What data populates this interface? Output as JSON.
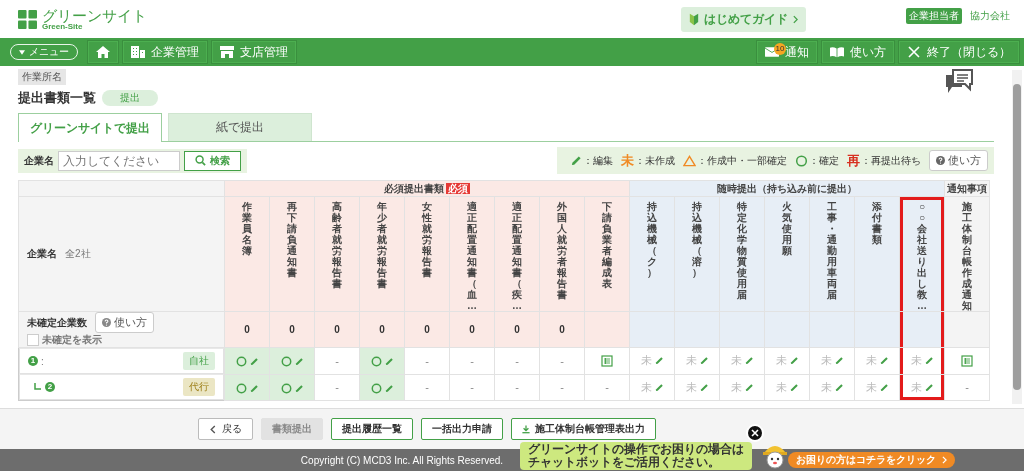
{
  "header": {
    "logo": {
      "name": "グリーンサイト",
      "subtitle": "Green-Site"
    },
    "guide_button": "はじめてガイド",
    "role_badge": "企業担当者",
    "company_link": "協力会社"
  },
  "navbar": {
    "menu_button": "メニュー",
    "items": [
      {
        "label": "企業管理",
        "kind": "building"
      },
      {
        "label": "支店管理",
        "kind": "store"
      }
    ],
    "notification": {
      "label": "通知",
      "count": "10"
    },
    "help": "使い方",
    "exit": "終了（閉じる）"
  },
  "site_label": "作業所名",
  "page": {
    "title": "提出書類一覧",
    "status": "提出"
  },
  "tabs": [
    {
      "label": "グリーンサイトで提出",
      "selected": true
    },
    {
      "label": "紙で提出",
      "selected": false
    }
  ],
  "search": {
    "label": "企業名",
    "placeholder": "入力してください",
    "button": "検索"
  },
  "legend": {
    "items": [
      {
        "kind": "pencil",
        "label": "：編集"
      },
      {
        "kind": "char",
        "symbol": "未",
        "color": "#f08a24",
        "label": "：未作成"
      },
      {
        "kind": "triangle",
        "label": "：作成中・一部確定"
      },
      {
        "kind": "circle",
        "label": "：確定"
      },
      {
        "kind": "char",
        "symbol": "再",
        "color": "#d7301f",
        "label": "：再提出待ち"
      }
    ],
    "help_button": "使い方"
  },
  "table": {
    "company_header": {
      "label": "企業名",
      "count": "全2社"
    },
    "unconfirmed": {
      "label": "未確定企業数",
      "help_button": "使い方",
      "show_unconfirmed": {
        "label": "未確定を表示",
        "checked": false
      }
    },
    "groups": [
      {
        "kind": "required",
        "title": "必須提出書類",
        "badge": "必須",
        "columns": [
          {
            "title": "作業員名簿",
            "count": "0",
            "highlighted": false
          },
          {
            "title": "再下請負通知書",
            "count": "0",
            "highlighted": false
          },
          {
            "title": "高齢者就労報告書",
            "count": "0",
            "highlighted": false
          },
          {
            "title": "年少者就労報告書",
            "count": "0",
            "highlighted": false
          },
          {
            "title": "女性就労報告書",
            "count": "0",
            "highlighted": false
          },
          {
            "title": "適正配置通知書（血…",
            "count": "0",
            "highlighted": false
          },
          {
            "title": "適正配置通知書（疾…",
            "count": "0",
            "highlighted": false
          },
          {
            "title": "外国人就労者報告書",
            "count": "0",
            "highlighted": false
          },
          {
            "title": "下請負業者編成表",
            "highlighted": false
          }
        ]
      },
      {
        "kind": "anytime",
        "title": "随時提出（持ち込み前に提出）",
        "columns": [
          {
            "title": "持込機械（ク）",
            "highlighted": false
          },
          {
            "title": "持込機械（溶）",
            "highlighted": false
          },
          {
            "title": "特定化学物質使用届",
            "highlighted": false
          },
          {
            "title": "火気使用願",
            "highlighted": false
          },
          {
            "title": "工事・通勤用車両届",
            "highlighted": false
          },
          {
            "title": "添付書類",
            "highlighted": false
          },
          {
            "title": "○○会社送り出し教…",
            "highlighted": true
          }
        ]
      },
      {
        "kind": "notice",
        "title": "通知事項",
        "columns": [
          {
            "title": "施工体制台帳作成通知",
            "highlighted": false
          }
        ]
      }
    ],
    "rows": [
      {
        "number": "1",
        "name": ":",
        "child": false,
        "tag": {
          "label": "自社",
          "kind": "own"
        },
        "cells": [
          {
            "kind": "confirmed"
          },
          {
            "kind": "confirmed"
          },
          {
            "kind": "empty",
            "text": "-"
          },
          {
            "kind": "confirmed"
          },
          {
            "kind": "empty",
            "text": "-"
          },
          {
            "kind": "empty",
            "text": "-"
          },
          {
            "kind": "empty",
            "text": "-"
          },
          {
            "kind": "empty",
            "text": "-"
          },
          {
            "kind": "document"
          },
          {
            "kind": "pending",
            "text": "未"
          },
          {
            "kind": "pending",
            "text": "未"
          },
          {
            "kind": "pending",
            "text": "未"
          },
          {
            "kind": "pending",
            "text": "未"
          },
          {
            "kind": "pending",
            "text": "未"
          },
          {
            "kind": "pending",
            "text": "未"
          },
          {
            "kind": "pending",
            "text": "未"
          },
          {
            "kind": "document"
          }
        ]
      },
      {
        "number": "2",
        "child": true,
        "tag": {
          "label": "代行",
          "kind": "proxy"
        },
        "cells": [
          {
            "kind": "confirmed"
          },
          {
            "kind": "confirmed"
          },
          {
            "kind": "empty",
            "text": "-"
          },
          {
            "kind": "confirmed"
          },
          {
            "kind": "empty",
            "text": "-"
          },
          {
            "kind": "empty",
            "text": "-"
          },
          {
            "kind": "empty",
            "text": "-"
          },
          {
            "kind": "empty",
            "text": "-"
          },
          {
            "kind": "empty",
            "text": "-"
          },
          {
            "kind": "pending",
            "text": "未"
          },
          {
            "kind": "pending",
            "text": "未"
          },
          {
            "kind": "pending",
            "text": "未"
          },
          {
            "kind": "pending",
            "text": "未"
          },
          {
            "kind": "pending",
            "text": "未"
          },
          {
            "kind": "pending",
            "text": "未"
          },
          {
            "kind": "pending",
            "text": "未"
          },
          {
            "kind": "empty",
            "text": "-"
          }
        ]
      }
    ]
  },
  "footer": {
    "buttons": [
      {
        "label": "戻る",
        "kind": "back",
        "disabled": false
      },
      {
        "label": "書類提出",
        "kind": "plain",
        "disabled": true
      },
      {
        "label": "提出履歴一覧",
        "kind": "plain",
        "disabled": false
      },
      {
        "label": "一括出力申請",
        "kind": "plain",
        "disabled": false
      },
      {
        "label": "施工体制台帳管理表出力",
        "kind": "download",
        "disabled": false
      }
    ],
    "copyright": "Copyright (C) MCD3 Inc. All Rights Reserved."
  },
  "chatbot": {
    "message_lines": [
      "グリーンサイトの操作でお困りの場合は",
      "チャットボットをご活用ください。"
    ],
    "button": "お困りの方はコチラをクリック"
  }
}
